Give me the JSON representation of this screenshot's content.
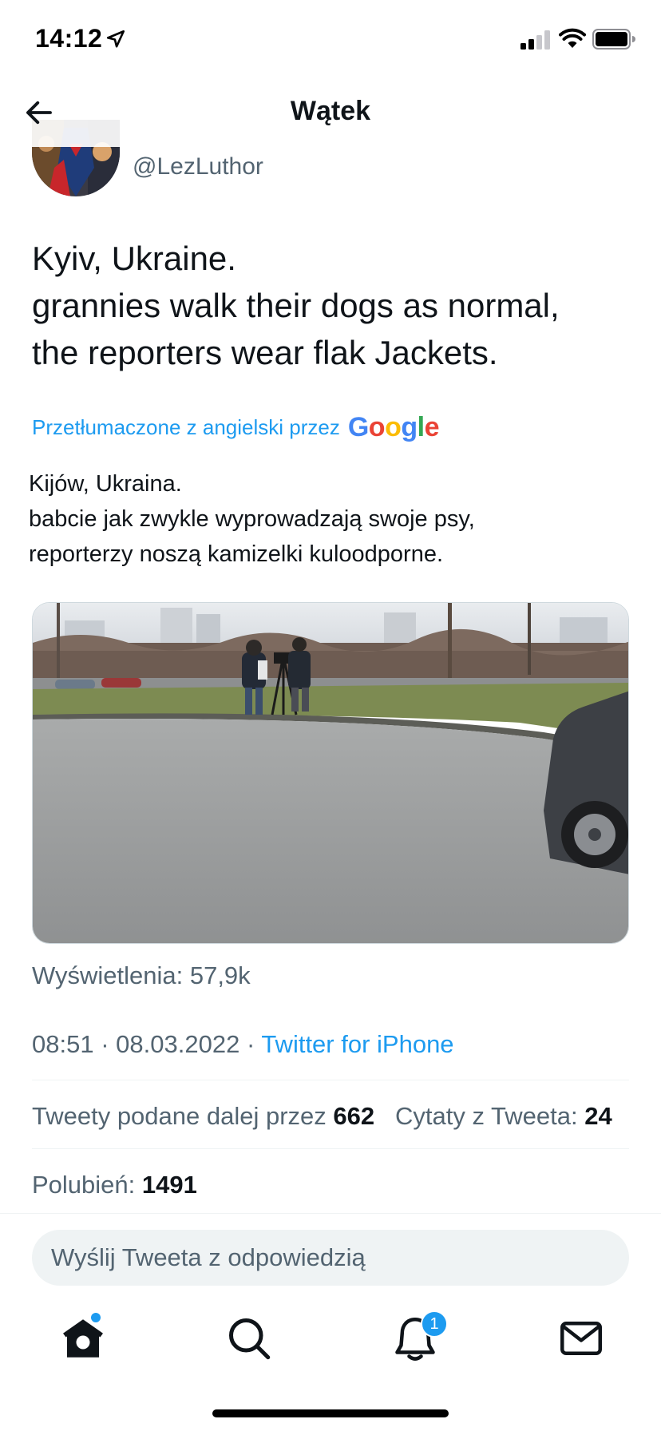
{
  "status_bar": {
    "time": "14:12",
    "icons": [
      "location-arrow-icon",
      "cellular-signal-icon",
      "wifi-icon",
      "battery-icon"
    ]
  },
  "header": {
    "title": "Wątek",
    "back_icon": "arrow-left-icon"
  },
  "tweet": {
    "handle": "@LezLuthor",
    "text": "Kyiv, Ukraine.\ngrannies walk their dogs as normal,\nthe reporters wear flak Jackets.",
    "translated_by_label": "Przetłumaczone z angielski przez",
    "translation_provider": "Google",
    "translation": "Kijów, Ukraina.\n babcie jak zwykle wyprowadzają swoje psy,\nreporterzy noszą kamizelki kuloodporne.",
    "views": "Wyświetlenia: 57,9k",
    "time": "08:51",
    "date": "08.03.2022",
    "separator": "·",
    "source": "Twitter for iPhone",
    "retweets_label": "Tweety podane dalej przez",
    "retweets_count": "662",
    "quotes_label": "Cytaty z Tweeta:",
    "quotes_count": "24",
    "likes_label": "Polubień:",
    "likes_count": "1491"
  },
  "reply": {
    "placeholder": "Wyślij Tweeta z odpowiedzią"
  },
  "tab_bar": {
    "items": [
      {
        "icon": "home-icon",
        "has_dot": true
      },
      {
        "icon": "search-icon"
      },
      {
        "icon": "bell-icon",
        "badge": "1"
      },
      {
        "icon": "mail-icon"
      }
    ]
  },
  "colors": {
    "accent": "#1d9bf0",
    "secondary_text": "#536471",
    "primary_text": "#0f1419"
  }
}
